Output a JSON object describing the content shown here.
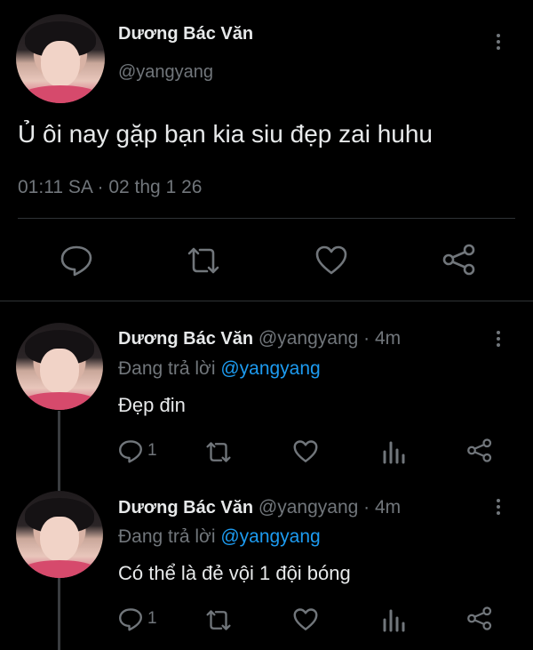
{
  "main_tweet": {
    "author_name": "Dương Bác Văn",
    "author_handle": "@yangyang",
    "text": "Ủ ôi nay gặp bạn kia siu đẹp zai huhu",
    "timestamp": "01:11 SA · 02 thg 1 26"
  },
  "replies": [
    {
      "author_name": "Dương Bác Văn",
      "handle_time": "@yangyang · 4m",
      "replying_prefix": "Đang trả lời ",
      "replying_to": "@yangyang",
      "text": "Đẹp đin",
      "reply_count": "1"
    },
    {
      "author_name": "Dương Bác Văn",
      "handle_time": "@yangyang · 4m",
      "replying_prefix": "Đang trả lời ",
      "replying_to": "@yangyang",
      "text": "Có thể là đẻ vội 1 đội bóng",
      "reply_count": "1"
    }
  ],
  "colors": {
    "background": "#000000",
    "text": "#e7e9ea",
    "muted": "#71767b",
    "link": "#1d9bf0",
    "divider": "#2f3336"
  },
  "icons": [
    "reply-icon",
    "retweet-icon",
    "like-icon",
    "share-icon",
    "analytics-icon",
    "more-icon"
  ]
}
